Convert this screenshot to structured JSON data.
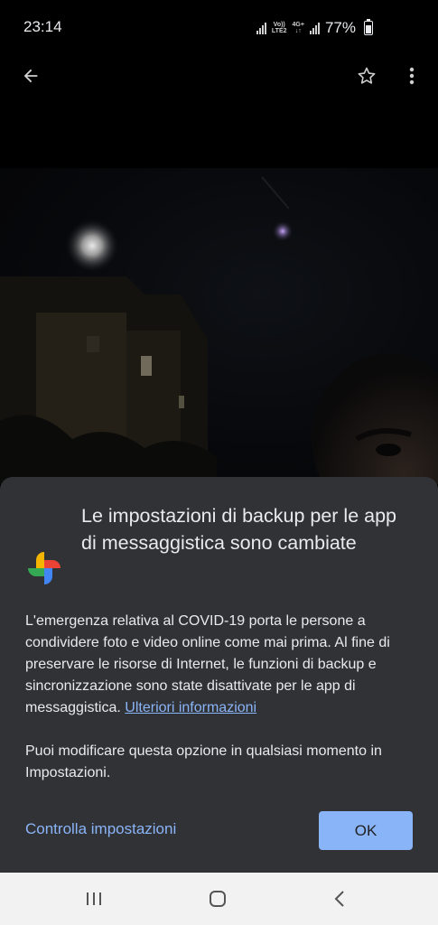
{
  "status_bar": {
    "time": "23:14",
    "network_line1": "Vo))",
    "network_line2": "LTE2",
    "data_line1": "4G+",
    "data_line2": "↓↑",
    "battery": "77%"
  },
  "toolbar": {
    "back_icon": "back-arrow-icon",
    "favorite_icon": "star-icon",
    "more_icon": "more-vert-icon"
  },
  "dialog": {
    "title": "Le impostazioni di backup per le app di messaggistica sono cambiate",
    "body_text": "L'emergenza relativa al COVID-19 porta le persone a condividere foto e video online come mai prima. Al fine di preservare le risorse di Internet, le funzioni di backup e sincronizzazione sono state disattivate per le app di messaggistica.",
    "link_text": "Ulteriori informazioni",
    "body_text_2": "Puoi modificare questa opzione in qualsiasi momento in Impostazioni.",
    "secondary_button": "Controlla impostazioni",
    "primary_button": "OK",
    "accent_color": "#8ab4f8",
    "background_color": "#313235"
  },
  "nav_bar": {
    "recents_icon": "recents-icon",
    "home_icon": "home-icon",
    "back_icon": "nav-back-icon"
  }
}
